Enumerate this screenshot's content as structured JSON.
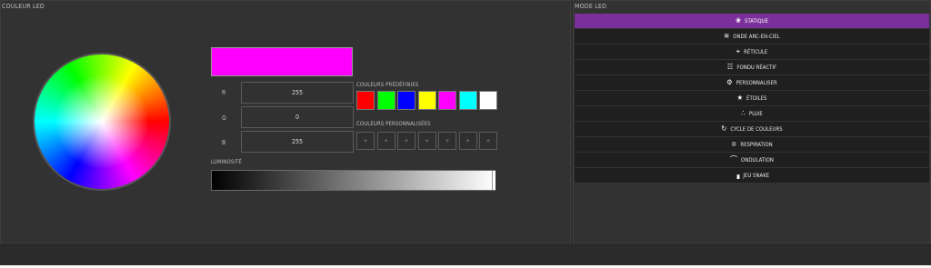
{
  "left_panel": {
    "title": "COULEUR LED"
  },
  "right_panel": {
    "title": "MODE LED"
  },
  "color": {
    "swatch": "#ff00ff",
    "r_label": "R",
    "r_value": "255",
    "g_label": "G",
    "g_value": "0",
    "b_label": "B",
    "b_value": "255"
  },
  "presets": {
    "label": "COULEURS PRÉDÉFINIES",
    "colors": [
      "#ff0000",
      "#00ff00",
      "#0000ff",
      "#ffff00",
      "#ff00ff",
      "#00ffff",
      "#ffffff"
    ]
  },
  "customs": {
    "label": "COULEURS PERSONNALISÉES",
    "slot_text": "+"
  },
  "brightness": {
    "label": "LUMINOSITÉ",
    "value_fraction": 1.0
  },
  "modes": [
    {
      "label": "STATIQUE",
      "icon": "palette-icon",
      "active": true
    },
    {
      "label": "ONDE ARC-EN-CIEL",
      "icon": "rainbow-icon",
      "active": false
    },
    {
      "label": "RÉTICULE",
      "icon": "crosshair-icon",
      "active": false
    },
    {
      "label": "FONDU RÉACTIF",
      "icon": "keyboard-fade-icon",
      "active": false
    },
    {
      "label": "PERSONNALISER",
      "icon": "gear-icon",
      "active": false
    },
    {
      "label": "ÉTOILES",
      "icon": "star-icon",
      "active": false
    },
    {
      "label": "PLUIE",
      "icon": "rain-icon",
      "active": false
    },
    {
      "label": "CYCLE DE COULEURS",
      "icon": "cycle-icon",
      "active": false
    },
    {
      "label": "RESPIRATION",
      "icon": "breathing-icon",
      "active": false
    },
    {
      "label": "ONDULATION",
      "icon": "ripple-icon",
      "active": false
    },
    {
      "label": "JEU SNAKE",
      "icon": "snake-icon",
      "active": false
    }
  ]
}
